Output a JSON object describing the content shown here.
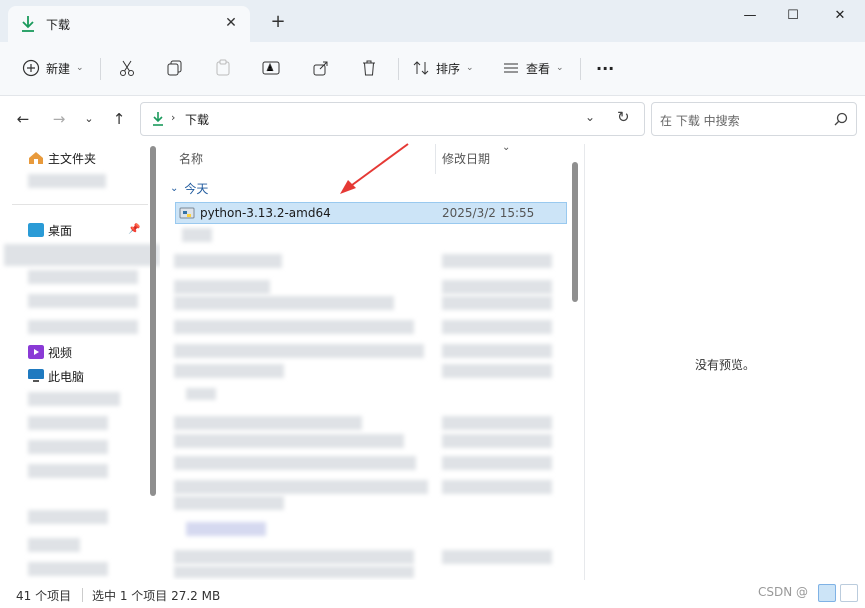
{
  "window": {
    "tab_title": "下载",
    "new_tab": "+",
    "minimize": "—",
    "maximize": "☐",
    "close": "✕"
  },
  "toolbar": {
    "new_label": "新建",
    "sort_label": "排序",
    "view_label": "查看",
    "more_label": "···"
  },
  "address": {
    "path": "下载",
    "search_placeholder": "在 下载 中搜索"
  },
  "sidebar": {
    "items": [
      {
        "label": "主文件夹",
        "icon": "home-icon"
      },
      {
        "label": "桌面",
        "icon": "desktop-icon"
      },
      {
        "label": "视频",
        "icon": "video-icon"
      },
      {
        "label": "此电脑",
        "icon": "pc-icon"
      }
    ]
  },
  "file_list": {
    "col_name": "名称",
    "col_date": "修改日期",
    "group_today": "今天",
    "selected_file": {
      "name": "python-3.13.2-amd64",
      "date": "2025/3/2 15:55"
    }
  },
  "preview": {
    "no_preview": "没有预览。"
  },
  "status": {
    "item_count": "41 个项目",
    "selection": "选中 1 个项目  27.2 MB",
    "watermark": "CSDN @"
  },
  "colors": {
    "accent": "#0067c0",
    "selection": "#cce4f7",
    "download_green": "#1a9a5c",
    "arrow_red": "#e53935"
  }
}
